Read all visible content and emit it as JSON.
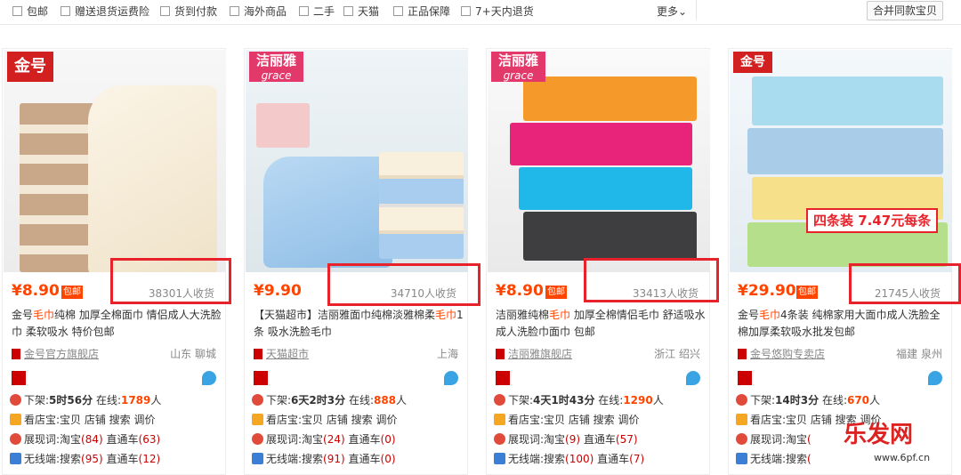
{
  "filters": [
    "包邮",
    "赠送退货运费险",
    "货到付款",
    "海外商品",
    "二手",
    "天猫",
    "正品保障",
    "7+天内退货"
  ],
  "more_label": "更多",
  "merge_label": "合并同款宝贝",
  "products": [
    {
      "brand": "金号",
      "price": "¥8.90",
      "baoyou": "包邮",
      "sales": "38301人收货",
      "title_pre": "金号",
      "title_hl": "毛巾",
      "title_post": "纯棉 加厚全棉面巾 情侣成人大洗脸巾 柔软吸水 特价包邮",
      "shop": "金号官方旗舰店",
      "location": "山东 聊城",
      "offshelf_label": "下架:",
      "offshelf": "5时56分",
      "online_label": "在线:",
      "online": "1789",
      "online_unit": "人",
      "line2": "看店宝:宝贝 店铺 搜索 调价",
      "line3_label": "展现词:淘宝",
      "line3_a": "(84)",
      "line3_b_label": "直通车",
      "line3_b": "(63)",
      "line4_label": "无线端:搜索",
      "line4_a": "(95)",
      "line4_b_label": "直通车",
      "line4_b": "(12)"
    },
    {
      "brand": "洁丽雅",
      "price": "¥9.90",
      "baoyou": "",
      "sales": "34710人收货",
      "title_pre": "【天猫超市】洁丽雅面巾纯棉淡雅棉柔",
      "title_hl": "毛巾",
      "title_post": "1条 吸水洗脸毛巾",
      "shop": "天猫超市",
      "location": "上海",
      "offshelf_label": "下架:",
      "offshelf": "6天2时3分",
      "online_label": "在线:",
      "online": "888",
      "online_unit": "人",
      "line2": "看店宝:宝贝 店铺 搜索 调价",
      "line3_label": "展现词:淘宝",
      "line3_a": "(24)",
      "line3_b_label": "直通车",
      "line3_b": "(0)",
      "line4_label": "无线端:搜索",
      "line4_a": "(91)",
      "line4_b_label": "直通车",
      "line4_b": "(0)"
    },
    {
      "brand": "洁丽雅",
      "price": "¥8.90",
      "baoyou": "包邮",
      "sales": "33413人收货",
      "title_pre": "洁丽雅纯棉",
      "title_hl": "毛巾",
      "title_post": " 加厚全棉情侣毛巾 舒适吸水 成人洗脸巾面巾 包邮",
      "shop": "洁丽雅旗舰店",
      "location": "浙江 绍兴",
      "offshelf_label": "下架:",
      "offshelf": "4天1时43分",
      "online_label": "在线:",
      "online": "1290",
      "online_unit": "人",
      "line2": "看店宝:宝贝 店铺 搜索 调价",
      "line3_label": "展现词:淘宝",
      "line3_a": "(9)",
      "line3_b_label": "直通车",
      "line3_b": "(57)",
      "line4_label": "无线端:搜索",
      "line4_a": "(100)",
      "line4_b_label": "直通车",
      "line4_b": "(7)"
    },
    {
      "brand": "金号",
      "price": "¥29.90",
      "baoyou": "包邮",
      "sales": "21745人收货",
      "title_pre": "金号",
      "title_hl": "毛巾",
      "title_post": "4条装 纯棉家用大面巾成人洗脸全棉加厚柔软吸水批发包邮",
      "shop": "金号悠购专卖店",
      "location": "福建 泉州",
      "offshelf_label": "下架:",
      "offshelf": "14时3分",
      "online_label": "在线:",
      "online": "670",
      "online_unit": "人",
      "line2": "看店宝:宝贝 店铺 搜索 调价",
      "line3_label": "展现词:淘宝",
      "line3_a": "(",
      "line3_b_label": "",
      "line3_b": "",
      "line4_label": "无线端:搜索",
      "line4_a": "(",
      "line4_b_label": "",
      "line4_b": "",
      "promo": "四条装 7.47元每条"
    }
  ],
  "watermark": "乐发网",
  "watermark_url": "www.6pf.cn",
  "colors": {
    "price": "#ff4400",
    "highlight_box": "#e8222b",
    "tmall_red": "#cc0000"
  }
}
